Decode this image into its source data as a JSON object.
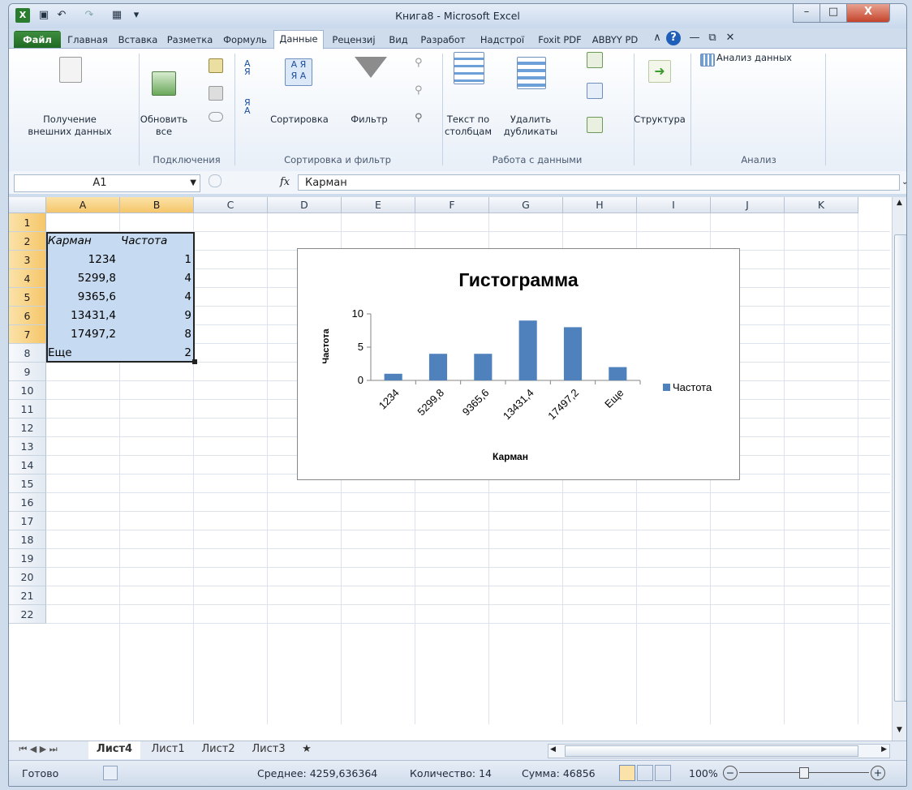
{
  "window": {
    "title": "Книга8 - Microsoft Excel",
    "close_glyph": "X",
    "min_glyph": "–",
    "max_glyph": "□"
  },
  "ribbon_tabs": [
    "Файл",
    "Главная",
    "Вставка",
    "Разметка",
    "Формуль",
    "Данные",
    "Рецензиј",
    "Вид",
    "Разработ",
    "Надстрої",
    "Foxit PDF",
    "ABBYY PD"
  ],
  "ribbon": {
    "external_line1": "Получение",
    "external_line2": "внешних данных",
    "refresh_line1": "Обновить",
    "refresh_line2": "все",
    "connections_group": "Подключения",
    "sort_label": "Сортировка",
    "filter_label": "Фильтр",
    "sort_filter_group": "Сортировка и фильтр",
    "text_to_cols_line1": "Текст по",
    "text_to_cols_line2": "столбцам",
    "remove_dup_line1": "Удалить",
    "remove_dup_line2": "дубликаты",
    "data_tools_group": "Работа с данными",
    "outline_label": "Структура",
    "analysis_button": "Анализ данных",
    "analysis_group": "Анализ"
  },
  "formula_bar": {
    "name_box": "A1",
    "fx": "fx",
    "content": "Карман"
  },
  "columns": [
    "A",
    "B",
    "C",
    "D",
    "E",
    "F",
    "G",
    "H",
    "I",
    "J",
    "K"
  ],
  "rows": [
    "1",
    "2",
    "3",
    "4",
    "5",
    "6",
    "7",
    "8",
    "9",
    "10",
    "11",
    "12",
    "13",
    "14",
    "15",
    "16",
    "17",
    "18",
    "19",
    "20",
    "21",
    "22"
  ],
  "cells": {
    "A1": "Карман",
    "B1": "Частота",
    "A2": "1234",
    "B2": "1",
    "A3": "5299,8",
    "B3": "4",
    "A4": "9365,6",
    "B4": "4",
    "A5": "13431,4",
    "B5": "9",
    "A6": "17497,2",
    "B6": "8",
    "A7": "Еще",
    "B7": "2"
  },
  "chart_data": {
    "type": "bar",
    "title": "Гистограмма",
    "xlabel": "Карман",
    "ylabel": "Частота",
    "categories": [
      "1234",
      "5299,8",
      "9365,6",
      "13431,4",
      "17497,2",
      "Еще"
    ],
    "series": [
      {
        "name": "Частота",
        "values": [
          1,
          4,
          4,
          9,
          8,
          2
        ]
      }
    ],
    "ylim": [
      0,
      10
    ],
    "yticks": [
      "0",
      "5",
      "10"
    ],
    "legend": "right",
    "color": "#4f81bd"
  },
  "sheet_tabs": [
    "Лист4",
    "Лист1",
    "Лист2",
    "Лист3"
  ],
  "status": {
    "ready": "Готово",
    "average": "Среднее: 4259,636364",
    "count": "Количество: 14",
    "sum": "Сумма: 46856",
    "zoom": "100%"
  }
}
